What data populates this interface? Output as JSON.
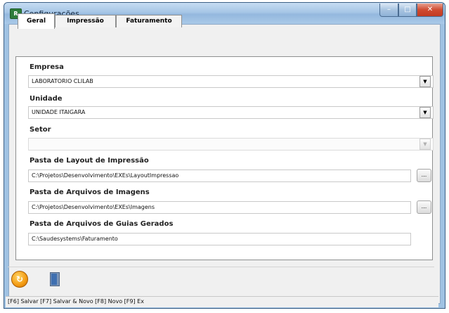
{
  "window": {
    "title": "Configurações",
    "controls": {
      "minimize": "–",
      "maximize": "□",
      "close": "✕"
    }
  },
  "tabs": [
    {
      "label": "Geral",
      "active": true
    },
    {
      "label": "Impressão",
      "active": false
    },
    {
      "label": "Faturamento",
      "active": false
    }
  ],
  "form": {
    "empresa": {
      "label": "Empresa",
      "value": "LABORATORIO CLILAB"
    },
    "unidade": {
      "label": "Unidade",
      "value": "UNIDADE ITAIGARA"
    },
    "setor": {
      "label": "Setor",
      "value": ""
    },
    "pasta_layout": {
      "label": "Pasta de Layout de Impressão",
      "value": "C:\\Projetos\\Desenvolvimento\\EXEs\\LayoutImpressao"
    },
    "pasta_imagens": {
      "label": "Pasta de Arquivos de Imagens",
      "value": "C:\\Projetos\\Desenvolvimento\\EXEs\\Imagens"
    },
    "pasta_guias": {
      "label": "Pasta de Arquivos de Guias Gerados",
      "value": "C:\\Saudesystems\\Faturamento"
    }
  },
  "buttons": {
    "dropdown_glyph": "▼",
    "browse_glyph": "..."
  },
  "toolbar": {
    "icons": [
      "save-icon",
      "exit-door-icon"
    ]
  },
  "statusbar": {
    "text": "[F6] Salvar [F7] Salvar & Novo [F8] Novo [F9] Ex"
  },
  "colors": {
    "titlebar": "#a6c6e6",
    "close_button": "#cf4b31",
    "form_bg": "#ffffff",
    "client_bg": "#f0f0f0"
  }
}
